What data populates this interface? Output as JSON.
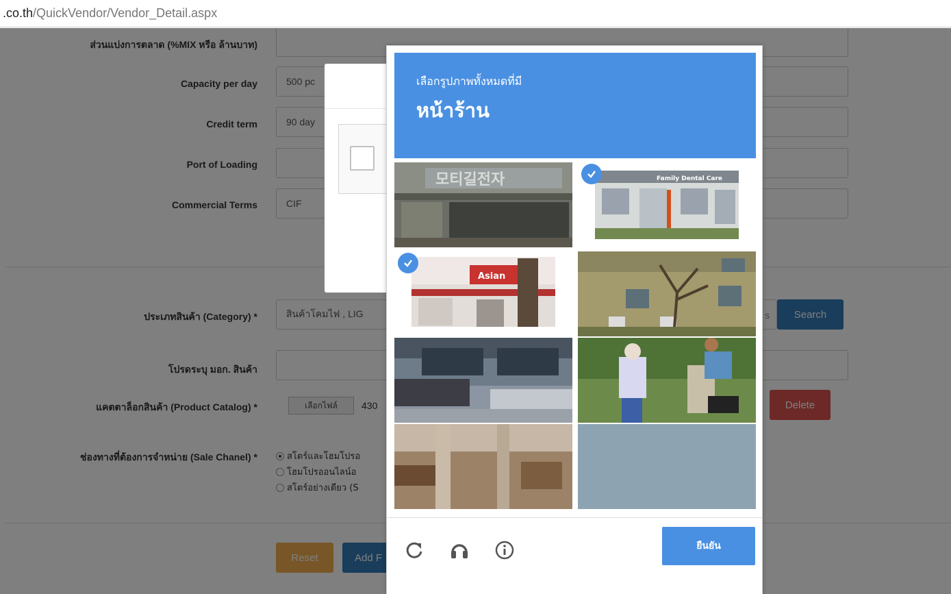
{
  "url": {
    "host": ".co.th",
    "path": "/QuickVendor/Vendor_Detail.aspx"
  },
  "form": {
    "top_label": "ส่วนแบ่งการตลาด (%MIX หรือ ล้านบาท)",
    "capacity_label": "Capacity per day",
    "capacity_value": "500 pc",
    "credit_label": "Credit term",
    "credit_value": "90 day",
    "port_label": "Port of Loading",
    "port_value": "",
    "commercial_label": "Commercial Terms",
    "commercial_value": "CIF",
    "category_label": "ประเภทสินค้า (Category) *",
    "category_value": "สินค้าโคมไฟ , LIG",
    "category_tail": "s",
    "search_label": "Search",
    "mok_label": "โปรดระบุ มอก. สินค้า",
    "mok_value": "",
    "catalog_label": "แคตตาล็อกสินค้า (Product Catalog) *",
    "file_button": "เลือกไฟล์",
    "file_name": "430",
    "delete_label": "Delete",
    "sale_label": "ช่องทางที่ต้องการจำหน่าย (Sale Chanel) *",
    "sale_options": [
      "สโตร์และโฮมโปรอ",
      "โฮมโปรออนไลน์อ",
      "สโตร์อย่างเดียว (S"
    ],
    "reset_label": "Reset",
    "add_label": "Add F"
  },
  "captcha": {
    "instruction": "เลือกรูปภาพทั้งหมดที่มี",
    "object": "หน้าร้าน",
    "verify_label": "ยืนยัน",
    "tiles": [
      {
        "desc": "korean storefront sign",
        "selected": false
      },
      {
        "desc": "family dental care storefront",
        "selected": true
      },
      {
        "desc": "restaurant storefront",
        "selected": true
      },
      {
        "desc": "building with tree",
        "selected": false
      },
      {
        "desc": "parking lot cars",
        "selected": false
      },
      {
        "desc": "people walking by fence",
        "selected": false
      },
      {
        "desc": "wooden wall utility pole",
        "selected": false
      },
      {
        "desc": "sky",
        "selected": false
      }
    ],
    "icons": [
      "reload-icon",
      "audio-icon",
      "info-icon"
    ]
  },
  "colors": {
    "captcha_blue": "#4a90e2",
    "search_blue": "#337ab7",
    "delete_red": "#d9534f",
    "reset_orange": "#f0ad4e"
  }
}
